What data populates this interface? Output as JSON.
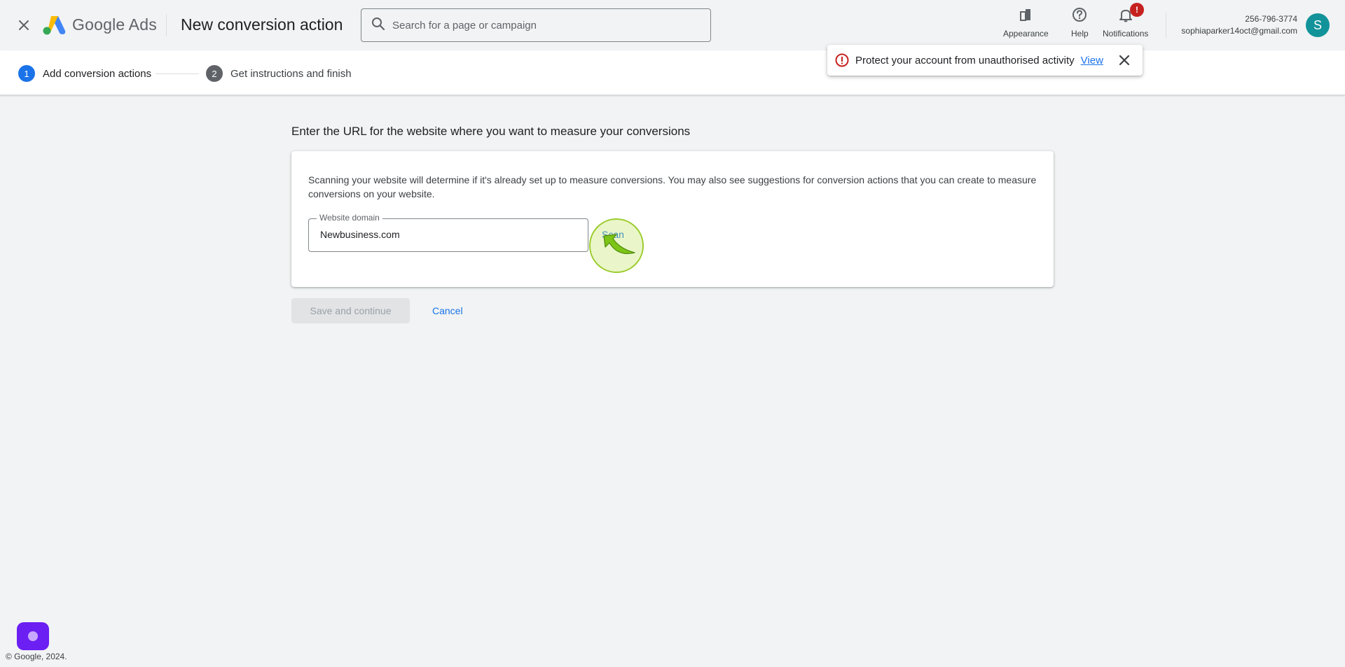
{
  "header": {
    "brand": "Google Ads",
    "page_title": "New conversion action",
    "search_placeholder": "Search for a page or campaign",
    "actions": {
      "appearance": "Appearance",
      "help": "Help",
      "notifications": "Notifications",
      "notifications_badge": "!"
    },
    "account": {
      "phone": "256-796-3774",
      "email": "sophiaparker14oct@gmail.com",
      "avatar_initial": "S",
      "avatar_color": "#12939a"
    }
  },
  "stepper": {
    "steps": [
      {
        "number": "1",
        "label": "Add conversion actions",
        "state": "active"
      },
      {
        "number": "2",
        "label": "Get instructions and finish",
        "state": "inactive"
      }
    ]
  },
  "toast": {
    "message": "Protect your account from unauthorised activity",
    "link": "View"
  },
  "main": {
    "heading": "Enter the URL for the website where you want to measure your conversions",
    "description": "Scanning your website will determine if it's already set up to measure conversions. You may also see suggestions for conversion actions that you can create to measure conversions on your website.",
    "field_label": "Website domain",
    "field_value": "Newbusiness.com",
    "scan_label": "Scan",
    "save_label": "Save and continue",
    "cancel_label": "Cancel"
  },
  "footer": {
    "copyright": "© Google, 2024."
  },
  "colors": {
    "accent": "#1a73e8",
    "error": "#c5221f",
    "assistant": "#6c1ff2"
  }
}
